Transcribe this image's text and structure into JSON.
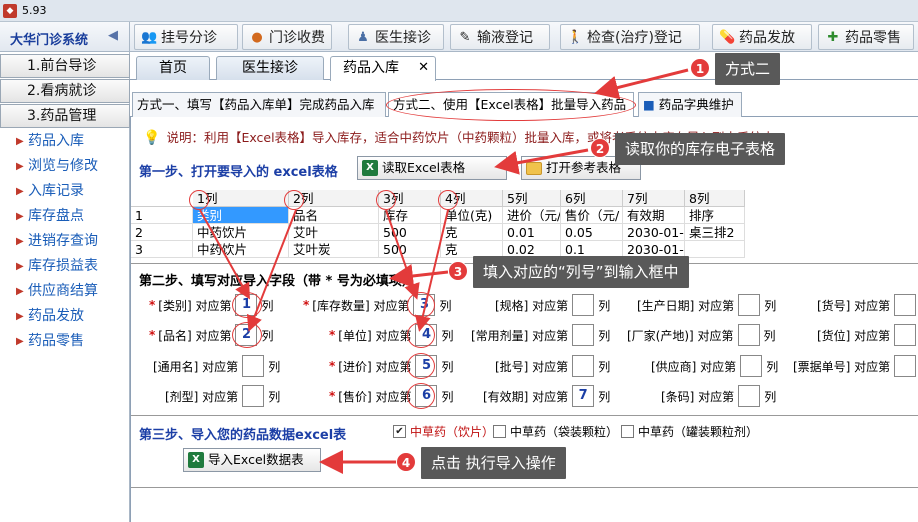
{
  "window": {
    "version": "5.93"
  },
  "system": {
    "name": "大华门诊系统"
  },
  "modules": [
    {
      "label": "挂号分诊",
      "icon": "people-icon"
    },
    {
      "label": "门诊收费",
      "icon": "coin-icon"
    },
    {
      "label": "医生接诊",
      "icon": "doctor-icon"
    },
    {
      "label": "输液登记",
      "icon": "syringe-icon"
    },
    {
      "label": "检查(治疗)登记",
      "icon": "walking-icon"
    },
    {
      "label": "药品发放",
      "icon": "pill-icon"
    },
    {
      "label": "药品零售",
      "icon": "plus-icon"
    }
  ],
  "sidebar": {
    "sections": [
      "1.前台导诊",
      "2.看病就诊",
      "3.药品管理"
    ],
    "items": [
      "药品入库",
      "浏览与修改",
      "入库记录",
      "库存盘点",
      "进销存查询",
      "库存损益表",
      "供应商结算",
      "药品发放",
      "药品零售"
    ]
  },
  "page_tabs": [
    "首页",
    "医生接诊",
    "药品入库"
  ],
  "sub_tabs": [
    "方式一、填写【药品入库单】完成药品入库",
    "方式二、使用【Excel表格】批量导入药品",
    "药品字典维护"
  ],
  "note": "说明：利用【Excel表格】导入库存，适合中药饮片（中药颗粒）批量入库，或将老系统中库存导入到本系统中",
  "step1": {
    "title": "第一步、打开要导入的 excel表格",
    "read_btn": "读取Excel表格",
    "open_btn": "打开参考表格"
  },
  "grid": {
    "headers": [
      "1列",
      "2列",
      "3列",
      "4列",
      "5列",
      "6列",
      "7列",
      "8列"
    ],
    "rows": [
      {
        "num": "1",
        "cells": [
          "类别",
          "品名",
          "库存",
          "单位(克)",
          "进价（元/",
          "售价（元/",
          "有效期",
          "排序"
        ]
      },
      {
        "num": "2",
        "cells": [
          "中药饮片",
          "艾叶",
          "500",
          "克",
          "0.01",
          "0.05",
          "2030-01-",
          "桌三排2"
        ]
      },
      {
        "num": "3",
        "cells": [
          "中药饮片",
          "艾叶炭",
          "500",
          "克",
          "0.02",
          "0.1",
          "2030-01-",
          ""
        ]
      }
    ]
  },
  "step2": {
    "title": "第二步、填写对应导入字段（带 * 号为必填项）",
    "fields": [
      {
        "label": "[类别] 对应第",
        "value": "1",
        "required": true
      },
      {
        "label": "[库存数量] 对应第",
        "value": "3",
        "required": true
      },
      {
        "label": "[规格] 对应第",
        "value": "",
        "required": false
      },
      {
        "label": "[生产日期] 对应第",
        "value": "",
        "required": false
      },
      {
        "label": "[货号] 对应第",
        "value": "",
        "required": false
      },
      {
        "label": "[品名] 对应第",
        "value": "2",
        "required": true
      },
      {
        "label": "[单位] 对应第",
        "value": "4",
        "required": true
      },
      {
        "label": "[常用剂量] 对应第",
        "value": "",
        "required": false
      },
      {
        "label": "[厂家(产地)] 对应第",
        "value": "",
        "required": false
      },
      {
        "label": "[货位] 对应第",
        "value": "",
        "required": false
      },
      {
        "label": "[通用名] 对应第",
        "value": "",
        "required": false
      },
      {
        "label": "[进价] 对应第",
        "value": "5",
        "required": true
      },
      {
        "label": "[批号] 对应第",
        "value": "",
        "required": false
      },
      {
        "label": "[供应商] 对应第",
        "value": "",
        "required": false
      },
      {
        "label": "[票据单号] 对应第",
        "value": "",
        "required": false
      },
      {
        "label": "[剂型] 对应第",
        "value": "",
        "required": false
      },
      {
        "label": "[售价] 对应第",
        "value": "6",
        "required": true
      },
      {
        "label": "[有效期] 对应第",
        "value": "7",
        "required": false
      },
      {
        "label": "[条码] 对应第",
        "value": "",
        "required": false
      }
    ],
    "suffix": "列",
    "overflow_suffix": "列"
  },
  "step3": {
    "title": "第三步、导入您的药品数据excel表",
    "options": [
      {
        "label": "中草药（饮片）",
        "checked": true
      },
      {
        "label": "中草药（袋装颗粒）",
        "checked": false
      },
      {
        "label": "中草药（罐装颗粒剂）",
        "checked": false
      }
    ],
    "import_btn": "导入Excel数据表"
  },
  "annotations": [
    {
      "num": "1",
      "text": "方式二"
    },
    {
      "num": "2",
      "text": "读取你的库存电子表格"
    },
    {
      "num": "3",
      "text": "填入对应的“列号”到输入框中"
    },
    {
      "num": "4",
      "text": "点击 执行导入操作"
    }
  ],
  "colors": {
    "accent_red": "#e33b3b",
    "callout_bg": "#595959",
    "label_blue": "#1c3fa6",
    "link_blue": "#1a5db8"
  }
}
